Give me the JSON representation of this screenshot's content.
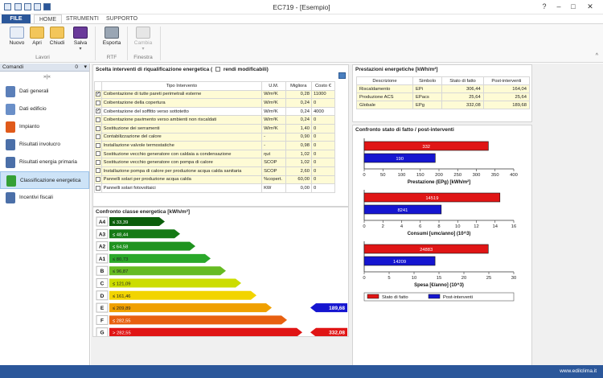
{
  "window": {
    "title": "EC719 - [Esempio]",
    "controls": [
      "?",
      "–",
      "□",
      "✕"
    ]
  },
  "menu_tabs": [
    "FILE",
    "HOME",
    "STRUMENTI",
    "SUPPORTO"
  ],
  "ribbon": {
    "groups": [
      {
        "label": "Lavori",
        "buttons": [
          "Nuovo",
          "Apri",
          "Chiudi",
          "Salva"
        ]
      },
      {
        "label": "RTF",
        "buttons": [
          "Esporta"
        ]
      },
      {
        "label": "Finestra",
        "buttons": [
          "Cambia"
        ]
      }
    ]
  },
  "sidebar": {
    "header": "Comandi",
    "count": "0",
    "collapse": "»|«",
    "items": [
      {
        "label": "Dati generali",
        "icon": "document-icon",
        "color": "#5b7fb9"
      },
      {
        "label": "Dati edificio",
        "icon": "building-icon",
        "color": "#6a8fc8"
      },
      {
        "label": "Impianto",
        "icon": "flame-icon",
        "color": "#e05a1a"
      },
      {
        "label": "Risultati involucro",
        "icon": "calculator-icon",
        "color": "#4b6fa8"
      },
      {
        "label": "Risultati energia primaria",
        "icon": "calculator-icon",
        "color": "#4b6fa8"
      },
      {
        "label": "Classificazione energetica",
        "icon": "energy-class-icon",
        "color": "#35a035"
      },
      {
        "label": "Incentivi fiscali",
        "icon": "list-icon",
        "color": "#4b6fa8"
      }
    ],
    "selected_index": 5
  },
  "interventions": {
    "title": "Scelta interventi di riqualificazione energetica (",
    "editable_label": "rendi modificabili)",
    "headers": [
      "",
      "Tipo Intervento",
      "U.M.",
      "Migliora",
      "Costo €"
    ],
    "rows": [
      {
        "checked": true,
        "name": "Coibentazione di tutte pareti perimetrali esterne",
        "um": "W/m²K",
        "migliora": "0,28",
        "costo": "11000",
        "highlight": true
      },
      {
        "checked": false,
        "name": "Coibentazione della copertura",
        "um": "W/m²K",
        "migliora": "0,24",
        "costo": "0",
        "highlight": true
      },
      {
        "checked": true,
        "name": "Coibentazione del soffitto verso sottotetto",
        "um": "W/m²K",
        "migliora": "0,24",
        "costo": "4000",
        "highlight": false
      },
      {
        "checked": false,
        "name": "Coibentazione pavimento verso ambienti non riscaldati",
        "um": "W/m²K",
        "migliora": "0,24",
        "costo": "0",
        "highlight": true
      },
      {
        "checked": false,
        "name": "Sostituzione dei serramenti",
        "um": "W/m²K",
        "migliora": "1,40",
        "costo": "0",
        "highlight": true
      },
      {
        "checked": false,
        "name": "Contabilizzazione del calore",
        "um": "-",
        "migliora": "0,90",
        "costo": "0",
        "highlight": true
      },
      {
        "checked": false,
        "name": "Installazione valvole termostatiche",
        "um": "-",
        "migliora": "0,98",
        "costo": "0",
        "highlight": true
      },
      {
        "checked": false,
        "name": "Sostituzione vecchio generatore con caldaia a condensazione",
        "um": "ηut",
        "migliora": "1,02",
        "costo": "0",
        "highlight": true
      },
      {
        "checked": false,
        "name": "Sostituzione vecchio generatore con pompa di calore",
        "um": "SCOP",
        "migliora": "1,02",
        "costo": "0",
        "highlight": true
      },
      {
        "checked": false,
        "name": "Installazione pompa di calore per produzione acqua calda sanitaria",
        "um": "SCOP",
        "migliora": "2,60",
        "costo": "0",
        "highlight": true
      },
      {
        "checked": false,
        "name": "Pannelli solari per produzione acqua calda",
        "um": "%copert.",
        "migliora": "60,00",
        "costo": "0",
        "highlight": true
      },
      {
        "checked": false,
        "name": "Pannelli solari fotovoltaici",
        "um": "KW",
        "migliora": "0,00",
        "costo": "0",
        "highlight": false
      }
    ]
  },
  "performance": {
    "title": "Prestazioni energetiche [kWh/m²]",
    "headers": [
      "Descrizione",
      "Simbolo",
      "Stato di fatto",
      "Post-interventi"
    ],
    "rows": [
      {
        "desc": "Riscaldamento",
        "sym": "EPi",
        "stato": "306,44",
        "post": "164,04"
      },
      {
        "desc": "Produzione ACS",
        "sym": "EPacs",
        "stato": "25,64",
        "post": "25,64"
      },
      {
        "desc": "Globale",
        "sym": "EPg",
        "stato": "332,08",
        "post": "189,68"
      }
    ]
  },
  "energy_class": {
    "title": "Confronto classe energetica [kWh/m²]",
    "classes": [
      {
        "label": "A4",
        "threshold": "≤ 33,39",
        "color": "#0b5e0b"
      },
      {
        "label": "A3",
        "threshold": "≤ 48,44",
        "color": "#157a15"
      },
      {
        "label": "A2",
        "threshold": "≤ 64,58",
        "color": "#1f931f"
      },
      {
        "label": "A1",
        "threshold": "≤ 80,73",
        "color": "#2aa82a"
      },
      {
        "label": "B",
        "threshold": "≤ 96,87",
        "color": "#66bb22"
      },
      {
        "label": "C",
        "threshold": "≤ 121,09",
        "color": "#ccdd00"
      },
      {
        "label": "D",
        "threshold": "≤ 161,46",
        "color": "#f2d400"
      },
      {
        "label": "E",
        "threshold": "≤ 209,89",
        "color": "#f0a000"
      },
      {
        "label": "F",
        "threshold": "≤ 282,55",
        "color": "#e86010"
      },
      {
        "label": "G",
        "threshold": "> 282,55",
        "color": "#e01515"
      }
    ],
    "markers": [
      {
        "class_index": 7,
        "value": "189,68",
        "color": "#1515d0"
      },
      {
        "class_index": 9,
        "value": "332,08",
        "color": "#e01515"
      }
    ]
  },
  "comparison": {
    "title": "Confronto stato di fatto / post-interventi",
    "legend": [
      "Stato di fatto",
      "Post-interventi"
    ],
    "colors": {
      "stato": "#e01515",
      "post": "#1515d0"
    }
  },
  "chart_data": [
    {
      "type": "bar",
      "orientation": "horizontal",
      "xlabel": "Prestazione (EPg) [kWh/m²]",
      "categories": [
        "Stato di fatto",
        "Post-interventi"
      ],
      "series": [
        {
          "name": "Stato di fatto",
          "values": [
            332
          ]
        },
        {
          "name": "Post-interventi",
          "values": [
            190
          ]
        }
      ],
      "value_labels": [
        "332",
        "190"
      ],
      "xlim": [
        0,
        400
      ],
      "ticks": [
        "0",
        "50",
        "100",
        "150",
        "200",
        "250",
        "300",
        "350",
        "400"
      ],
      "tick_values": [
        0,
        50,
        100,
        150,
        200,
        250,
        300,
        350,
        400
      ]
    },
    {
      "type": "bar",
      "orientation": "horizontal",
      "xlabel": "Consumi [umc/anno] (10^3)",
      "categories": [
        "Stato di fatto",
        "Post-interventi"
      ],
      "series": [
        {
          "name": "Stato di fatto",
          "values": [
            14519
          ]
        },
        {
          "name": "Post-interventi",
          "values": [
            8241
          ]
        }
      ],
      "value_labels": [
        "14519",
        "8241"
      ],
      "xlim": [
        0,
        16000
      ],
      "ticks": [
        "0",
        "2",
        "4",
        "6",
        "8",
        "10",
        "12",
        "14",
        "16"
      ],
      "tick_values": [
        0,
        2000,
        4000,
        6000,
        8000,
        10000,
        12000,
        14000,
        16000
      ]
    },
    {
      "type": "bar",
      "orientation": "horizontal",
      "xlabel": "Spesa [€/anno] (10^3)",
      "categories": [
        "Stato di fatto",
        "Post-interventi"
      ],
      "series": [
        {
          "name": "Stato di fatto",
          "values": [
            24883
          ]
        },
        {
          "name": "Post-interventi",
          "values": [
            14209
          ]
        }
      ],
      "value_labels": [
        "24883",
        "14209"
      ],
      "xlim": [
        0,
        30000
      ],
      "ticks": [
        "0",
        "5",
        "10",
        "15",
        "20",
        "25",
        "30"
      ],
      "tick_values": [
        0,
        5000,
        10000,
        15000,
        20000,
        25000,
        30000
      ]
    }
  ],
  "statusbar": {
    "text": "www.edilclima.it"
  }
}
